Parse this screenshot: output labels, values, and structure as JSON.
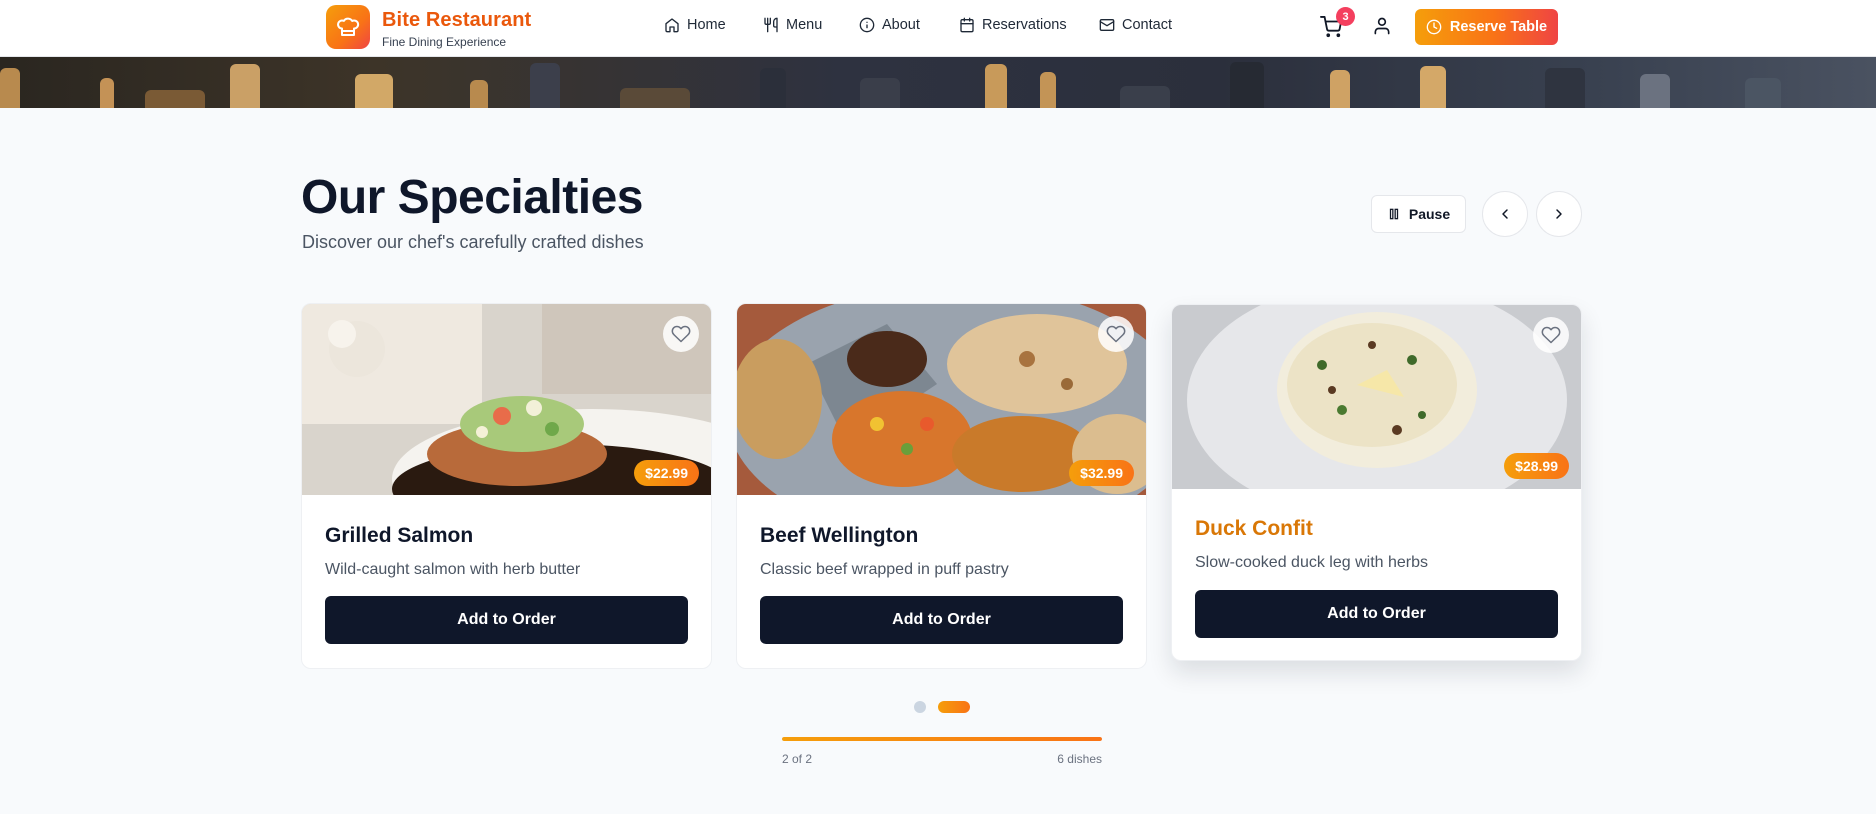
{
  "brand": {
    "name": "Bite Restaurant",
    "tagline": "Fine Dining Experience",
    "logo_icon": "chef-hat-icon",
    "accent_color": "#f97316"
  },
  "nav": {
    "items": [
      {
        "label": "Home",
        "icon": "home-icon"
      },
      {
        "label": "Menu",
        "icon": "utensils-icon"
      },
      {
        "label": "About",
        "icon": "info-icon"
      },
      {
        "label": "Reservations",
        "icon": "calendar-icon"
      },
      {
        "label": "Contact",
        "icon": "mail-icon"
      }
    ]
  },
  "header_actions": {
    "cart_count": "3",
    "reserve_label": "Reserve Table"
  },
  "section": {
    "title": "Our Specialties",
    "subtitle": "Discover our chef's carefully crafted dishes",
    "pause_label": "Pause"
  },
  "cards": [
    {
      "name": "Grilled Salmon",
      "description": "Wild-caught salmon with herb butter",
      "price": "$22.99",
      "button": "Add to Order",
      "name_color": "#0f172a"
    },
    {
      "name": "Beef Wellington",
      "description": "Classic beef wrapped in puff pastry",
      "price": "$32.99",
      "button": "Add to Order",
      "name_color": "#0f172a"
    },
    {
      "name": "Duck Confit",
      "description": "Slow-cooked duck leg with herbs",
      "price": "$28.99",
      "button": "Add to Order",
      "name_color": "#d97706"
    }
  ],
  "carousel": {
    "active_page": 2,
    "total_pages": 2,
    "page_label": "2 of 2",
    "count_label": "6 dishes",
    "progress": 1.0
  }
}
